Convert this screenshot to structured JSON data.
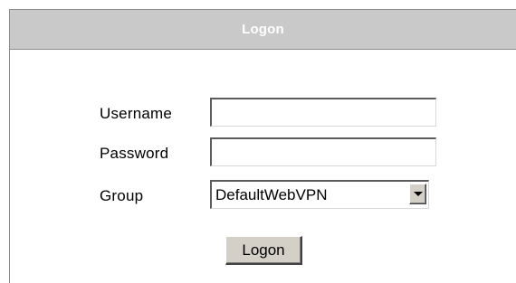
{
  "header": {
    "title": "Logon"
  },
  "form": {
    "username_label": "Username",
    "username_value": "",
    "password_label": "Password",
    "password_value": "",
    "group_label": "Group",
    "group_selected": "DefaultWebVPN",
    "submit_label": "Logon"
  }
}
